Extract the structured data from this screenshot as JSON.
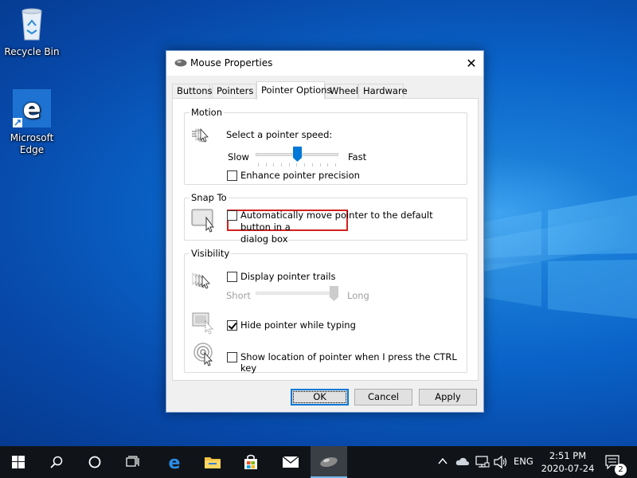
{
  "desktop": {
    "icons": [
      {
        "label": "Recycle Bin"
      },
      {
        "label_line1": "Microsoft",
        "label_line2": "Edge"
      }
    ]
  },
  "dialog": {
    "title": "Mouse Properties",
    "close_glyph": "✕",
    "tabs": [
      {
        "label": "Buttons"
      },
      {
        "label": "Pointers"
      },
      {
        "label": "Pointer Options",
        "active": true
      },
      {
        "label": "Wheel"
      },
      {
        "label": "Hardware"
      }
    ],
    "motion": {
      "legend": "Motion",
      "speed_label": "Select a pointer speed:",
      "slow_label": "Slow",
      "fast_label": "Fast",
      "speed_level": 0.5,
      "enhance_label": "Enhance pointer precision",
      "enhance_checked": false
    },
    "snap_to": {
      "legend": "Snap To",
      "auto_move_line1": "Automatically move pointer to the default button in a",
      "auto_move_line2": "dialog box",
      "auto_move_checked": false
    },
    "visibility": {
      "legend": "Visibility",
      "trails_label": "Display pointer trails",
      "trails_checked": false,
      "short_label": "Short",
      "long_label": "Long",
      "trails_level": 1.0,
      "hide_label": "Hide pointer while typing",
      "hide_checked": true,
      "ctrl_label": "Show location of pointer when I press the CTRL key",
      "ctrl_checked": false
    },
    "buttons": {
      "ok": "OK",
      "cancel": "Cancel",
      "apply": "Apply"
    },
    "accent_color": "#0078d7",
    "highlight_color": "#d42020"
  },
  "taskbar": {
    "language": "ENG",
    "time": "2:51 PM",
    "date": "2020-07-24",
    "notification_count": "2"
  }
}
